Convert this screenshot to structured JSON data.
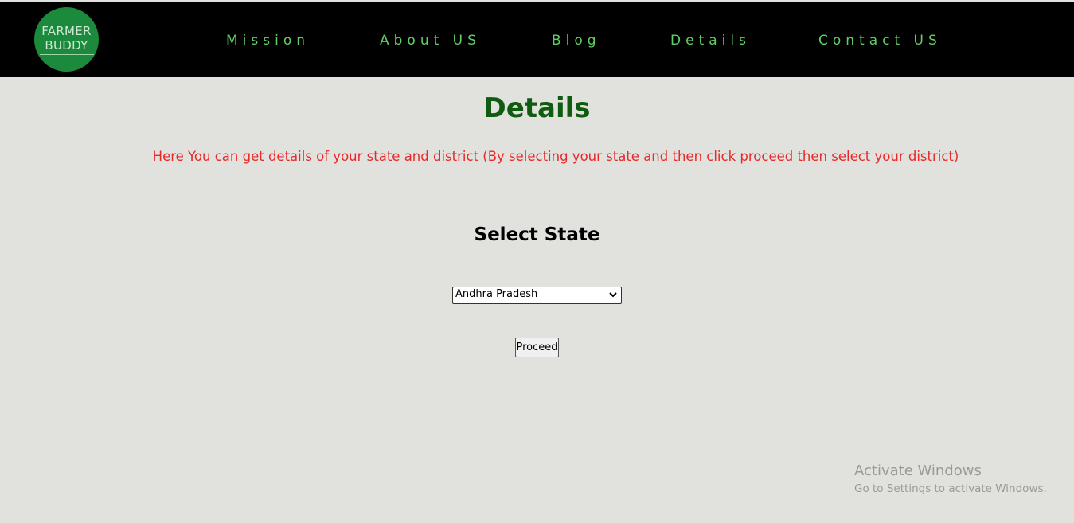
{
  "logo": {
    "line1": "FARMER",
    "line2": "BUDDY"
  },
  "nav": {
    "items": [
      {
        "label": "Mission"
      },
      {
        "label": "About US"
      },
      {
        "label": "Blog"
      },
      {
        "label": "Details"
      },
      {
        "label": "Contact US"
      }
    ]
  },
  "main": {
    "title": "Details",
    "description": "Here You can get details of your state and district (By selecting your state and then click proceed then select your district)",
    "select_heading": "Select State",
    "state_select": {
      "selected": "Andhra Pradesh"
    },
    "proceed_label": "Proceed"
  },
  "os_watermark": {
    "line1": "Activate Windows",
    "line2": "Go to Settings to activate Windows."
  },
  "colors": {
    "navbar_bg": "#000000",
    "nav_text": "#5fcf66",
    "logo_bg": "#1b8a3c",
    "page_bg": "#e1e2dd",
    "title": "#0f5b0f",
    "description": "#e8292b"
  }
}
